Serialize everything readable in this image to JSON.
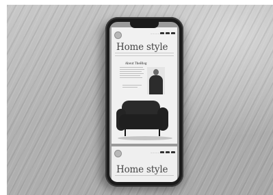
{
  "template": {
    "title": "Home style",
    "about_heading": "About TheBlog"
  }
}
